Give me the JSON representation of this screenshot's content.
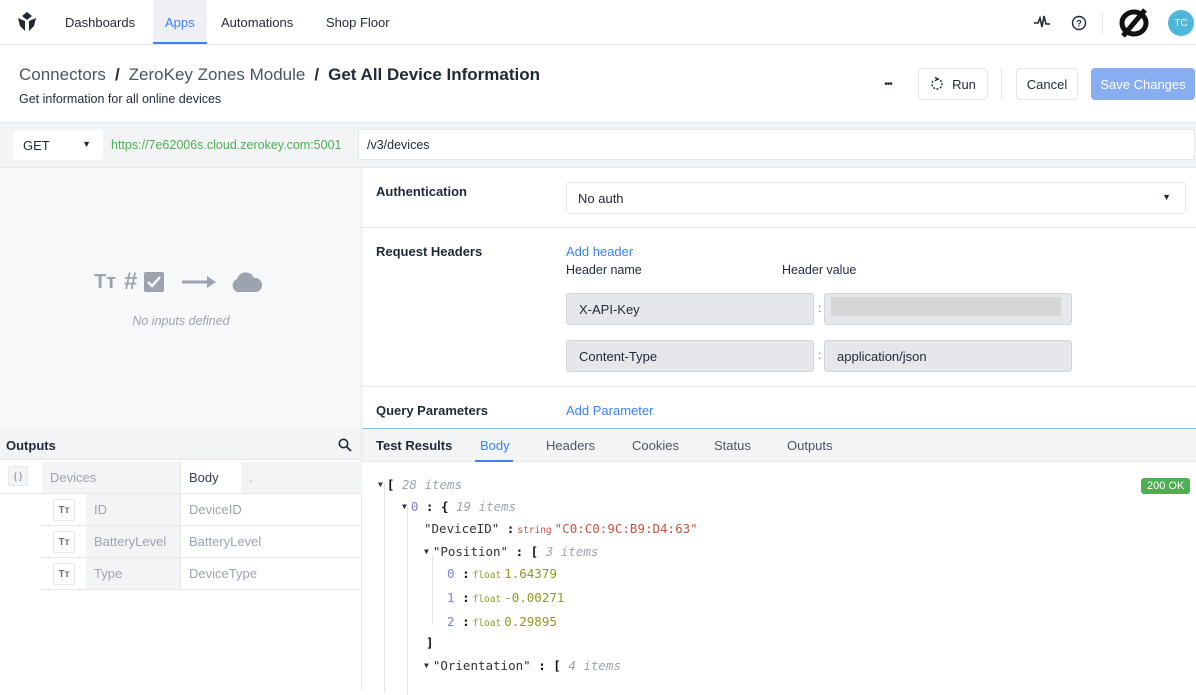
{
  "nav": {
    "items": [
      {
        "label": "Dashboards",
        "active": false
      },
      {
        "label": "Apps",
        "active": true
      },
      {
        "label": "Automations",
        "active": false
      },
      {
        "label": "Shop Floor",
        "active": false
      }
    ],
    "user_initials": "TC",
    "icons": [
      "activity-icon",
      "help-icon",
      "brand-logo-icon"
    ]
  },
  "header": {
    "breadcrumb": [
      "Connectors",
      "ZeroKey Zones Module",
      "Get All Device Information"
    ],
    "separator": "/",
    "subtitle": "Get information for all online devices",
    "more_label": "•••",
    "run_label": "Run",
    "cancel_label": "Cancel",
    "save_label": "Save Changes"
  },
  "request": {
    "method": "GET",
    "base_url": "https://7e62006s.cloud.zerokey.com:5001",
    "path": "/v3/devices"
  },
  "inputs": {
    "empty_text": "No inputs defined",
    "icon_text": "Tт"
  },
  "outputs": {
    "title": "Outputs",
    "root": {
      "name": "Devices",
      "source": "Body",
      "path": "."
    },
    "fields": [
      {
        "name": "ID",
        "path": "DeviceID"
      },
      {
        "name": "BatteryLevel",
        "path": "BatteryLevel"
      },
      {
        "name": "Type",
        "path": "DeviceType"
      }
    ]
  },
  "config": {
    "auth_label": "Authentication",
    "auth_value": "No auth",
    "headers_label": "Request Headers",
    "add_header": "Add header",
    "header_name_col": "Header name",
    "header_value_col": "Header value",
    "headers": [
      {
        "name": "X-API-Key",
        "value": "",
        "redacted": true
      },
      {
        "name": "Content-Type",
        "value": "application/json",
        "redacted": false
      }
    ],
    "query_label": "Query Parameters",
    "add_parameter": "Add Parameter"
  },
  "results": {
    "title": "Test Results",
    "tabs": [
      "Body",
      "Headers",
      "Cookies",
      "Status",
      "Outputs"
    ],
    "active_tab": "Body",
    "status": "200 OK",
    "json": {
      "root_count": "28 items",
      "item0_index": "0",
      "item0_count": "19 items",
      "device_id_key": "\"DeviceID\"",
      "device_id_type": "string",
      "device_id_value": "\"C0:C0:9C:B9:D4:63\"",
      "position_key": "\"Position\"",
      "position_count": "3 items",
      "position": [
        {
          "index": "0",
          "type": "float",
          "value": "1.64379"
        },
        {
          "index": "1",
          "type": "float",
          "value": "-0.00271"
        },
        {
          "index": "2",
          "type": "float",
          "value": "0.29895"
        }
      ],
      "orientation_key": "\"Orientation\"",
      "orientation_count": "4 items"
    }
  }
}
